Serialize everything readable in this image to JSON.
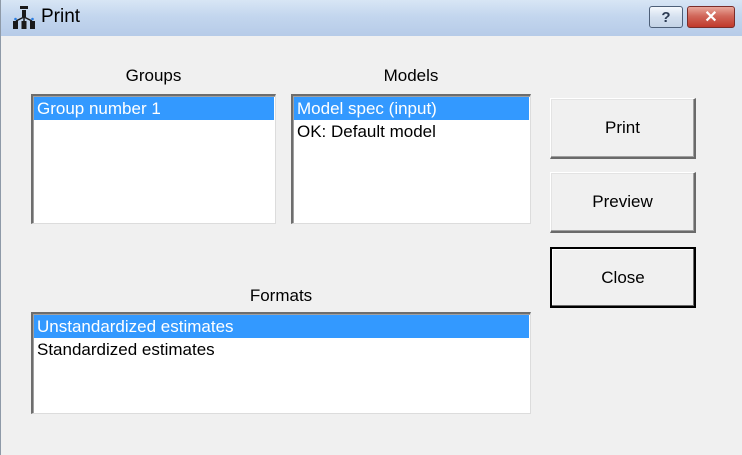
{
  "window": {
    "title": "Print",
    "help_glyph": "?",
    "close_glyph": "✕"
  },
  "groups": {
    "label": "Groups",
    "items": [
      {
        "label": "Group number 1",
        "selected": true
      }
    ]
  },
  "models": {
    "label": "Models",
    "items": [
      {
        "label": "Model spec (input)",
        "selected": true
      },
      {
        "label": "OK: Default model",
        "selected": false
      }
    ]
  },
  "formats": {
    "label": "Formats",
    "items": [
      {
        "label": "Unstandardized estimates",
        "selected": true
      },
      {
        "label": "Standardized estimates",
        "selected": false
      }
    ]
  },
  "buttons": {
    "print": "Print",
    "preview": "Preview",
    "close": "Close"
  },
  "colors": {
    "selection": "#3399ff",
    "titlebar": "#c3d6ee",
    "close_button": "#c0392b"
  },
  "icons": {
    "app": "amos-path-diagram-icon",
    "help": "help-icon",
    "close": "close-icon"
  }
}
